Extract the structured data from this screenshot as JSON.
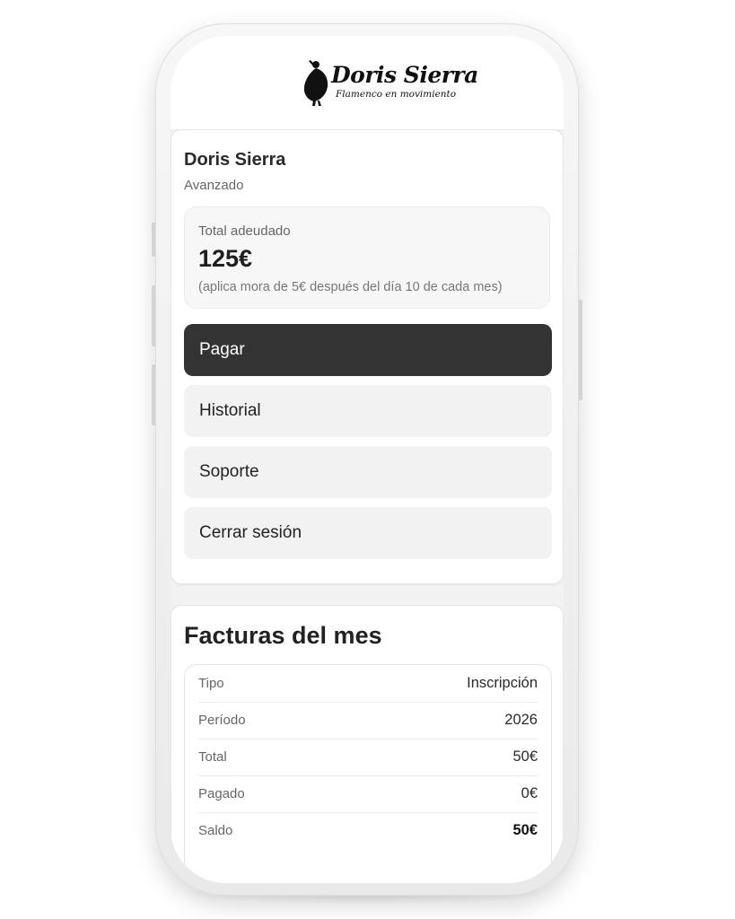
{
  "brand": {
    "name": "Doris Sierra",
    "tagline": "Flamenco en movimiento"
  },
  "student": {
    "name": "Doris Sierra",
    "level": "Avanzado"
  },
  "debt": {
    "label": "Total adeudado",
    "amount": "125€",
    "note": "(aplica mora de 5€ después del día 10 de cada mes)"
  },
  "menu": {
    "pay": "Pagar",
    "history": "Historial",
    "support": "Soporte",
    "logout": "Cerrar sesión"
  },
  "invoices": {
    "title": "Facturas del mes",
    "rows": [
      {
        "key": "Tipo",
        "value": "Inscripción"
      },
      {
        "key": "Período",
        "value": "2026"
      },
      {
        "key": "Total",
        "value": "50€"
      },
      {
        "key": "Pagado",
        "value": "0€"
      },
      {
        "key": "Saldo",
        "value": "50€"
      }
    ]
  },
  "colors": {
    "primary_button": "#333333",
    "secondary_button": "#f2f2f2",
    "card_background": "#ffffff"
  }
}
